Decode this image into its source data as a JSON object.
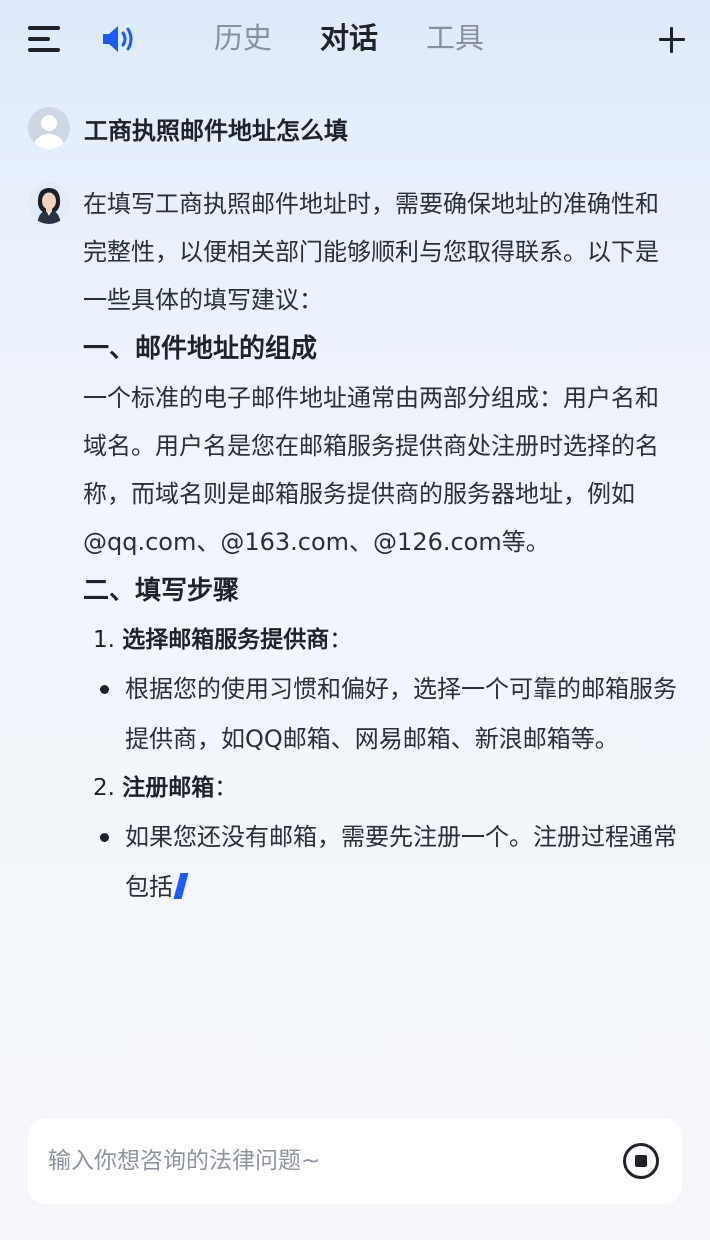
{
  "header": {
    "icons": {
      "menu": "menu-icon",
      "speaker": "speaker-icon",
      "new_chat": "plus-icon"
    },
    "accent_color": "#1e5bff",
    "tabs": [
      {
        "label": "历史",
        "active": false
      },
      {
        "label": "对话",
        "active": true
      },
      {
        "label": "工具",
        "active": false
      }
    ]
  },
  "question": {
    "text": "工商执照邮件地址怎么填"
  },
  "answer": {
    "intro": "在填写工商执照邮件地址时，需要确保地址的准确性和完整性，以便相关部门能够顺利与您取得联系。以下是一些具体的填写建议：",
    "section1_title": "一、邮件地址的组成",
    "section1_text": "一个标准的电子邮件地址通常由两部分组成：用户名和域名。用户名是您在邮箱服务提供商处注册时选择的名称，而域名则是邮箱服务提供商的服务器地址，例如@qq.com、@163.com、@126.com等。",
    "section2_title": "二、填写步骤",
    "step1_number": "1.",
    "step1_title": "选择邮箱服务提供商",
    "step1_bullet": "根据您的使用习惯和偏好，选择一个可靠的邮箱服务提供商，如QQ邮箱、网易邮箱、新浪邮箱等。",
    "step2_number": "2.",
    "step2_title": "注册邮箱",
    "step2_bullet": "如果您还没有邮箱，需要先注册一个。注册过程通常包括"
  },
  "input": {
    "placeholder": "输入你想咨询的法律问题~",
    "value": ""
  }
}
